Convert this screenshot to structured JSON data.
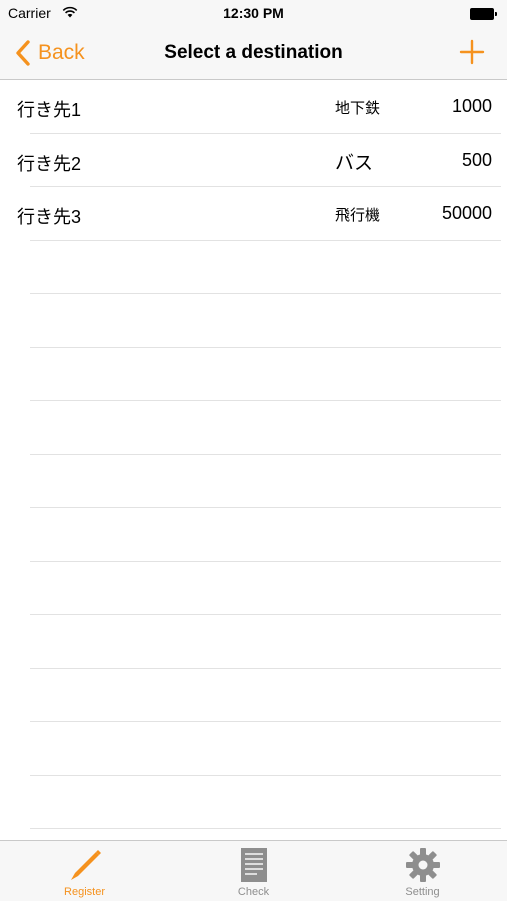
{
  "status_bar": {
    "carrier": "Carrier",
    "time": "12:30 PM"
  },
  "nav": {
    "back_label": "Back",
    "title": "Select a destination"
  },
  "destinations": [
    {
      "name": "行き先1",
      "mode": "地下鉄",
      "price": "1000"
    },
    {
      "name": "行き先2",
      "mode": "バス",
      "price": "500"
    },
    {
      "name": "行き先3",
      "mode": "飛行機",
      "price": "50000"
    }
  ],
  "tabs": [
    {
      "label": "Register",
      "icon": "pencil-icon",
      "active": true
    },
    {
      "label": "Check",
      "icon": "document-icon",
      "active": false
    },
    {
      "label": "Setting",
      "icon": "gear-icon",
      "active": false
    }
  ],
  "colors": {
    "accent": "#f5921e",
    "inactive": "#8e8e8e",
    "bar_bg": "#f7f7f7",
    "separator": "#e2e2e2"
  }
}
